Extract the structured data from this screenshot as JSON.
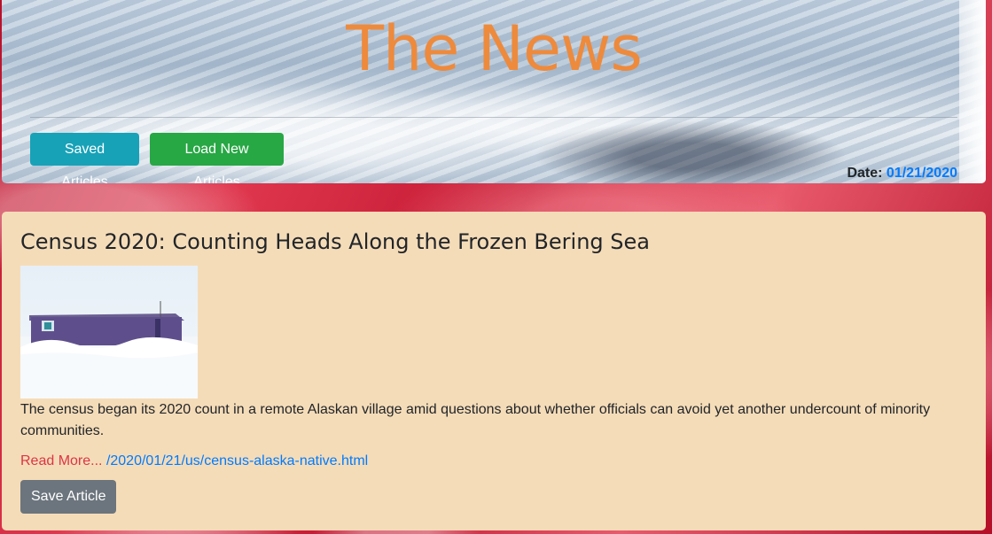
{
  "header": {
    "title": "The News",
    "buttons": {
      "saved_articles": "Saved Articles",
      "load_new_articles": "Load New Articles"
    },
    "date_label": "Date:",
    "date_value": "01/21/2020"
  },
  "article": {
    "title": "Census 2020: Counting Heads Along the Frozen Bering Sea",
    "summary": "The census began its 2020 count in a remote Alaskan village amid questions about whether officials can avoid yet another undercount of minority communities.",
    "read_more_label": "Read More...",
    "link_text": "/2020/01/21/us/census-alaska-native.html",
    "save_button": "Save Article",
    "image_icon": "snowy-house-photo"
  },
  "colors": {
    "title_orange": "#ee8a3c",
    "saved_btn": "#17a2b8",
    "load_btn": "#28a745",
    "card_bg": "#f5dcb8",
    "link_blue": "#007bff",
    "read_more_red": "#dc3545",
    "save_btn": "#6c757d"
  }
}
